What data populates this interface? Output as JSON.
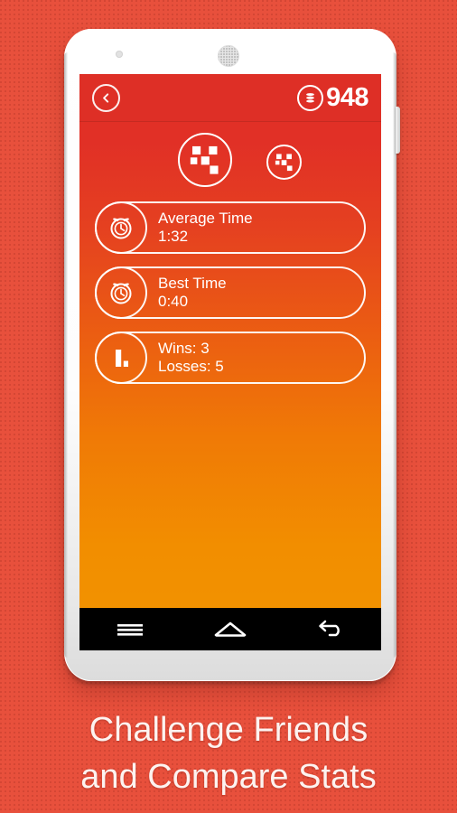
{
  "promo": {
    "background_color": "#e8503c",
    "caption_line1": "Challenge Friends",
    "caption_line2": "and Compare Stats"
  },
  "device": {
    "frame_color": "#ffffff",
    "camera_icon": "camera-dot-icon",
    "speaker_icon": "speaker-grille-icon",
    "power_button": "power-button"
  },
  "app": {
    "accent_top_color": "#e13026",
    "accent_bottom_color": "#f29400",
    "header": {
      "back_icon": "chevron-left-icon",
      "coin_icon": "coin-stack-icon",
      "coin_count": "948"
    },
    "dice": {
      "large_icon": "dice-five-icon",
      "small_icon": "dice-five-icon"
    },
    "stats": [
      {
        "icon": "alarm-clock-icon",
        "label": "Average Time",
        "value": "1:32"
      },
      {
        "icon": "alarm-clock-icon",
        "label": "Best Time",
        "value": "0:40"
      },
      {
        "icon": "bar-chart-icon",
        "label": "Wins: 3",
        "value": "Losses: 5"
      }
    ]
  },
  "android_nav": {
    "background_color": "#000000",
    "buttons": [
      {
        "icon": "menu-icon",
        "name": "menu"
      },
      {
        "icon": "home-icon",
        "name": "home"
      },
      {
        "icon": "back-arrow-icon",
        "name": "back"
      }
    ]
  }
}
